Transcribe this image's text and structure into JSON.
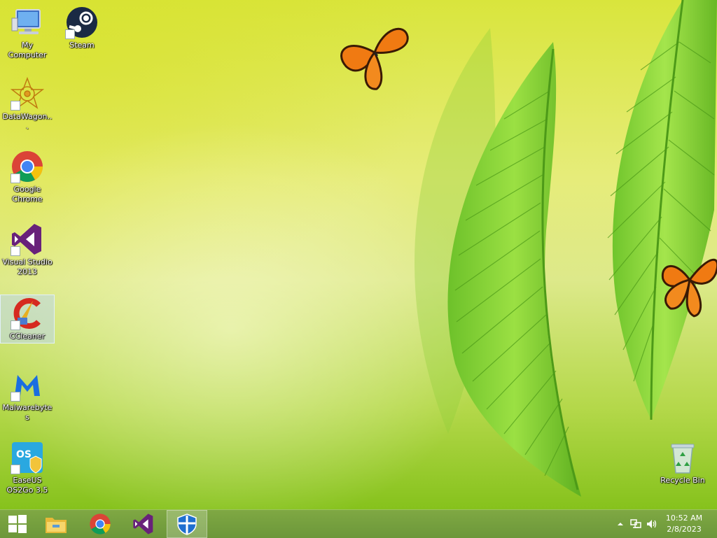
{
  "desktop": {
    "icons": [
      {
        "label": "My Computer"
      },
      {
        "label": "Steam"
      },
      {
        "label": "DataWagon..."
      },
      {
        "label": "Google Chrome"
      },
      {
        "label": "Visual Studio 2013"
      },
      {
        "label": "CCleaner"
      },
      {
        "label": "Malwarebytes"
      },
      {
        "label": "EaseUS OS2Go 3.5"
      },
      {
        "label": "Recycle Bin"
      }
    ]
  },
  "taskbar": {
    "pinned": [
      "start-button",
      "file-explorer",
      "google-chrome",
      "visual-studio",
      "security-app"
    ],
    "clock": {
      "time": "10:52 AM",
      "date": "2/8/2023"
    }
  },
  "colors": {
    "taskbar": "#76a03f",
    "wallpaper_top": "#d9e53c",
    "wallpaper_bottom": "#86c21c"
  }
}
